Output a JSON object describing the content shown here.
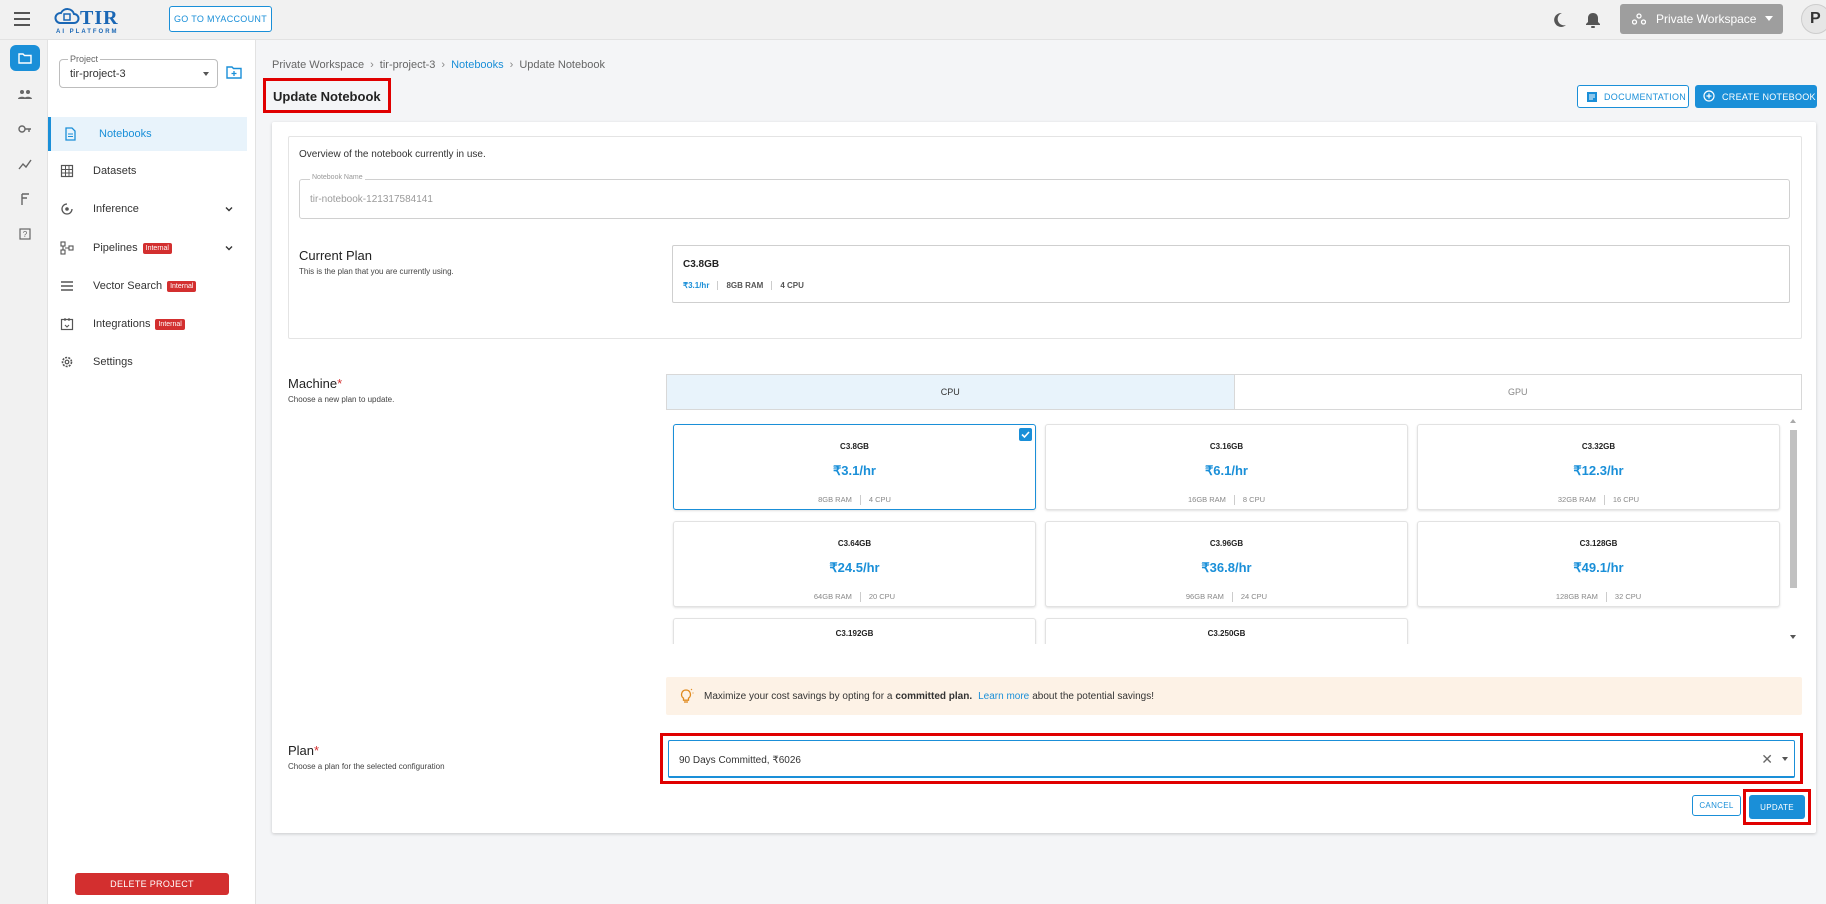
{
  "header": {
    "logo_title": "TIR",
    "logo_subtitle": "AI PLATFORM",
    "go_myaccount": "GO TO MYACCOUNT",
    "workspace": "Private Workspace",
    "avatar_initial": "P"
  },
  "sidebar": {
    "project_label": "Project",
    "project_value": "tir-project-3",
    "items": [
      {
        "label": "Notebooks",
        "badge": "",
        "active": true
      },
      {
        "label": "Datasets",
        "badge": ""
      },
      {
        "label": "Inference",
        "badge": "",
        "expandable": true
      },
      {
        "label": "Pipelines",
        "badge": "Internal",
        "expandable": true
      },
      {
        "label": "Vector Search",
        "badge": "Internal"
      },
      {
        "label": "Integrations",
        "badge": "Internal"
      },
      {
        "label": "Settings",
        "badge": ""
      }
    ],
    "delete_project": "DELETE PROJECT"
  },
  "breadcrumb": [
    "Private Workspace",
    "tir-project-3",
    "Notebooks",
    "Update Notebook"
  ],
  "page_title": "Update Notebook",
  "actions": {
    "documentation": "DOCUMENTATION",
    "create_notebook": "CREATE NOTEBOOK"
  },
  "overview": {
    "text": "Overview of the notebook currently in use.",
    "notebook_name_label": "Notebook Name",
    "notebook_name_value": "tir-notebook-121317584141",
    "current_plan_title": "Current Plan",
    "current_plan_sub": "This is the plan that you are currently using.",
    "current_plan": {
      "name": "C3.8GB",
      "price": "₹3.1/hr",
      "ram": "8GB RAM",
      "cpu": "4 CPU"
    }
  },
  "machine": {
    "title": "Machine",
    "required_mark": "*",
    "sub": "Choose a new plan to update.",
    "tabs": [
      "CPU",
      "GPU"
    ],
    "active_tab": "CPU",
    "plans": [
      {
        "name": "C3.8GB",
        "price": "₹3.1/hr",
        "ram": "8GB RAM",
        "cpu": "4 CPU",
        "selected": true
      },
      {
        "name": "C3.16GB",
        "price": "₹6.1/hr",
        "ram": "16GB RAM",
        "cpu": "8 CPU"
      },
      {
        "name": "C3.32GB",
        "price": "₹12.3/hr",
        "ram": "32GB RAM",
        "cpu": "16 CPU"
      },
      {
        "name": "C3.64GB",
        "price": "₹24.5/hr",
        "ram": "64GB RAM",
        "cpu": "20 CPU"
      },
      {
        "name": "C3.96GB",
        "price": "₹36.8/hr",
        "ram": "96GB RAM",
        "cpu": "24 CPU"
      },
      {
        "name": "C3.128GB",
        "price": "₹49.1/hr",
        "ram": "128GB RAM",
        "cpu": "32 CPU"
      },
      {
        "name": "C3.192GB",
        "price": "",
        "ram": "",
        "cpu": ""
      },
      {
        "name": "C3.250GB",
        "price": "",
        "ram": "",
        "cpu": ""
      }
    ]
  },
  "tip": {
    "prefix": "Maximize your cost savings by opting for a",
    "bold": "committed plan.",
    "link": "Learn more",
    "suffix": "about the potential savings!"
  },
  "plan": {
    "title": "Plan",
    "required_mark": "*",
    "sub": "Choose a plan for the selected configuration",
    "value": "90 Days Committed, ₹6026"
  },
  "buttons": {
    "cancel": "CANCEL",
    "update": "UPDATE"
  },
  "colors": {
    "accent": "#1a8fd8",
    "danger": "#d32f2f",
    "highlight": "#e00000"
  }
}
